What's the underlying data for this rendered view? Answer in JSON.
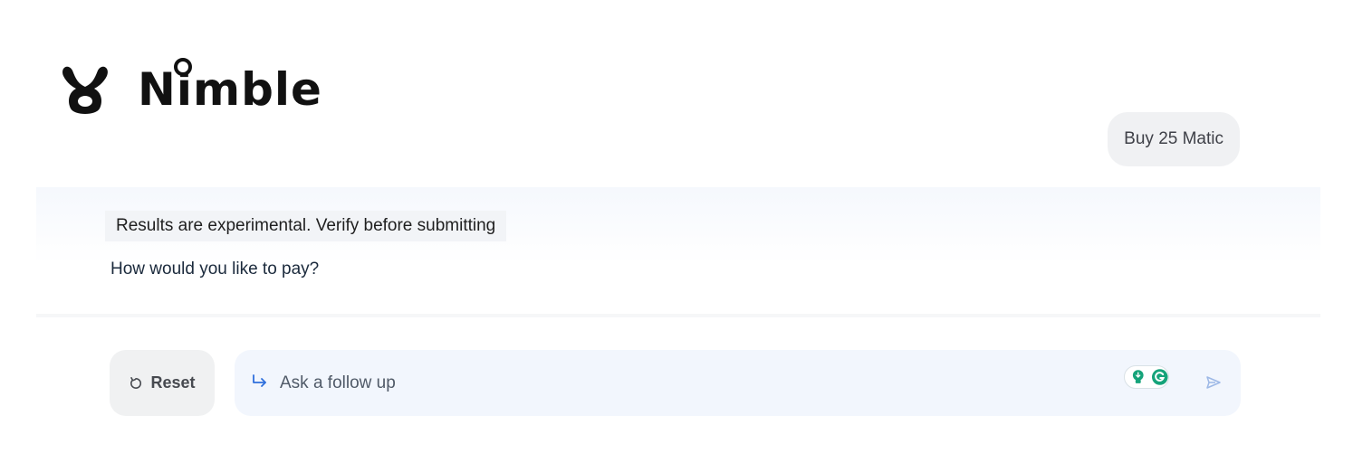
{
  "brand": {
    "logo_icon": "bunny-logo-icon",
    "name": "Nimble",
    "name_color": "#111111"
  },
  "conversation": {
    "user_message": "Buy 25 Matic",
    "disclaimer": "Results are experimental. Verify before submitting",
    "assistant_reply": "How would you like to pay?"
  },
  "controls": {
    "reset_label": "Reset",
    "reset_icon": "refresh-icon",
    "followup_icon": "reply-arrow-icon",
    "followup_placeholder": "Ask a follow up",
    "followup_value": "",
    "extension_icons": [
      "lightbulb-icon",
      "grammarly-icon"
    ],
    "send_icon": "send-icon"
  },
  "colors": {
    "panel_background": "#f5f8fd",
    "input_background": "#f2f6fd",
    "accent_blue": "#2f6fdc",
    "extension_green": "#15a37a"
  }
}
